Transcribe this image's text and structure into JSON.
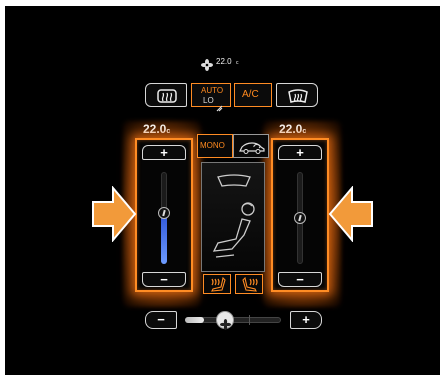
{
  "status": {
    "fan_icon": "fan-icon",
    "temperature": "22.0",
    "unit": "c"
  },
  "top_buttons": {
    "rear_defrost_icon": "rear-defrost-icon",
    "auto_label": "AUTO",
    "auto_sub": "LO",
    "ac_label": "A/C",
    "front_defrost_icon": "front-defrost-icon"
  },
  "left_zone": {
    "temperature": "22.0",
    "unit": "c",
    "plus": "+",
    "minus": "−",
    "level": 0.55
  },
  "right_zone": {
    "temperature": "22.0",
    "unit": "c",
    "plus": "+",
    "minus": "−",
    "level": 0.0
  },
  "center": {
    "mono_label": "MONO",
    "car_icon": "recirculation-car-icon",
    "windshield_icon": "windshield-airflow-icon",
    "seat_icon": "seat-airflow-icon",
    "left_seat_heat_icon": "left-seat-heat-icon",
    "right_seat_heat_icon": "right-seat-heat-icon"
  },
  "fan": {
    "minus": "−",
    "plus": "+",
    "level": 0.2,
    "icon": "fan-icon"
  },
  "colors": {
    "accent": "#ff8c24",
    "slider_active": "#4d7bff",
    "arrow": "#f29a3a"
  }
}
